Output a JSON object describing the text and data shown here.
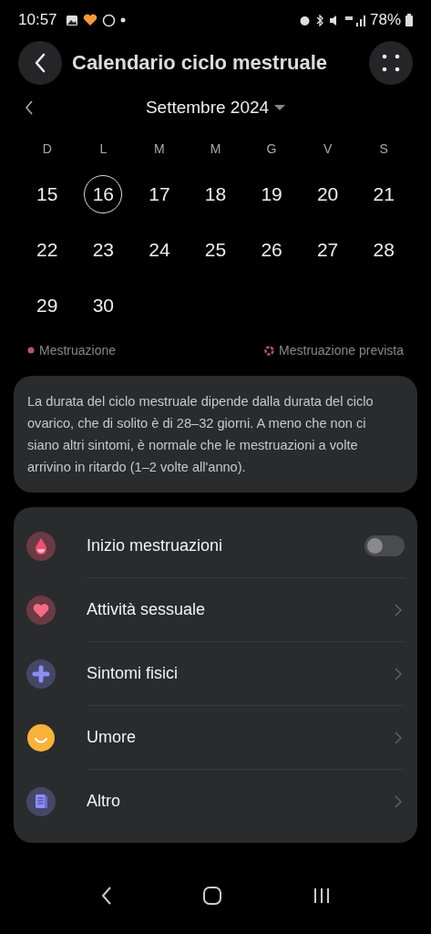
{
  "status_bar": {
    "time": "10:57",
    "battery": "78%"
  },
  "header": {
    "title": "Calendario ciclo mestruale"
  },
  "calendar": {
    "month": "Settembre 2024",
    "weekdays": [
      "D",
      "L",
      "M",
      "M",
      "G",
      "V",
      "S"
    ],
    "weeks": [
      [
        {
          "label": "15",
          "selected": false
        },
        {
          "label": "16",
          "selected": true
        },
        {
          "label": "17",
          "selected": false
        },
        {
          "label": "18",
          "selected": false
        },
        {
          "label": "19",
          "selected": false
        },
        {
          "label": "20",
          "selected": false
        },
        {
          "label": "21",
          "selected": false
        }
      ],
      [
        {
          "label": "22",
          "selected": false
        },
        {
          "label": "23",
          "selected": false
        },
        {
          "label": "24",
          "selected": false
        },
        {
          "label": "25",
          "selected": false
        },
        {
          "label": "26",
          "selected": false
        },
        {
          "label": "27",
          "selected": false
        },
        {
          "label": "28",
          "selected": false
        }
      ],
      [
        {
          "label": "29",
          "selected": false
        },
        {
          "label": "30",
          "selected": false
        }
      ]
    ]
  },
  "legend": [
    {
      "label": "Mestruazione",
      "kind": "filled",
      "color": "#b0566a"
    },
    {
      "label": "Mestruazione prevista",
      "kind": "dashed",
      "color": "#b0566a"
    }
  ],
  "info": "La durata del ciclo mestruale dipende dalla durata del ciclo ovarico, che di solito è di 28–32 giorni. A meno che non ci siano altri sintomi, è normale che le mestruazioni a volte arrivino in ritardo (1–2 volte all'anno).",
  "items": [
    {
      "label": "Inizio mestruazioni",
      "kind": "toggle",
      "on": false
    },
    {
      "label": "Attività sessuale",
      "kind": "link"
    },
    {
      "label": "Sintomi fisici",
      "kind": "link"
    },
    {
      "label": "Umore",
      "kind": "link"
    },
    {
      "label": "Altro",
      "kind": "link"
    }
  ]
}
